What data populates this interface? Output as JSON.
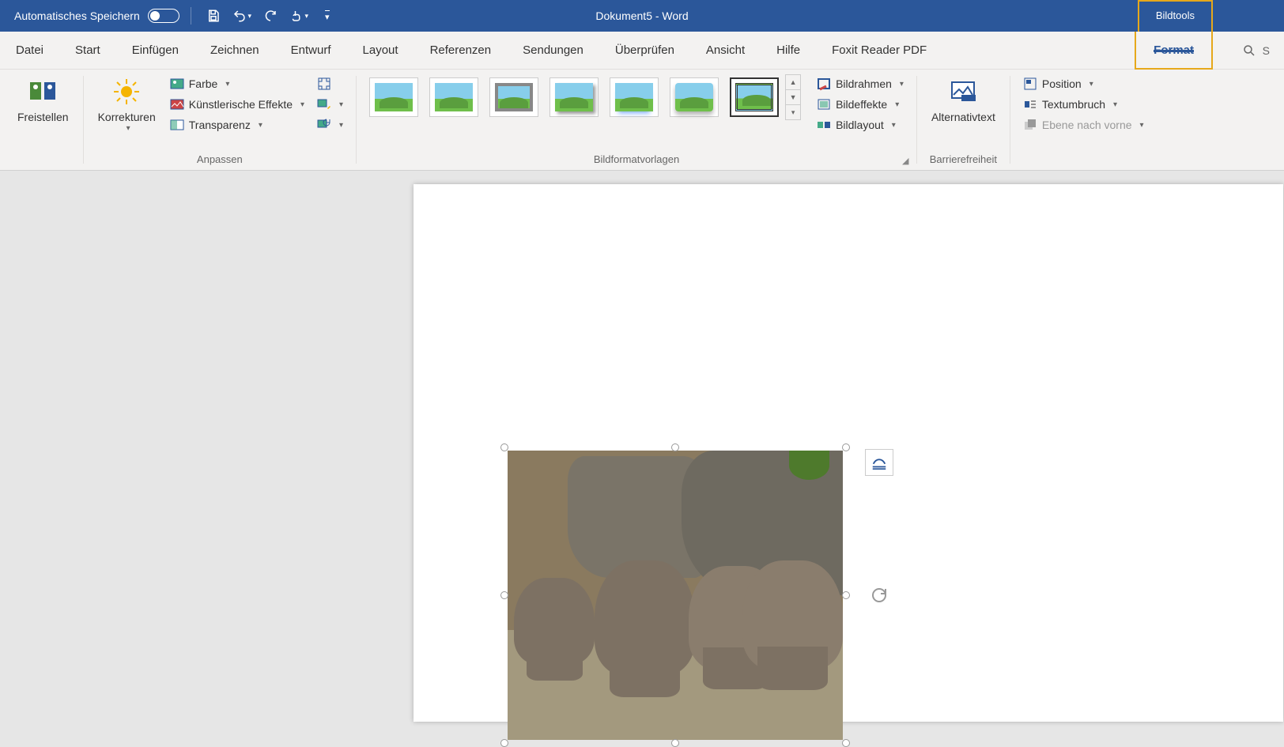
{
  "title_bar": {
    "autosave_label": "Automatisches Speichern",
    "doc_title": "Dokument5  -  Word",
    "context_tab": "Bildtools"
  },
  "tabs": {
    "datei": "Datei",
    "start": "Start",
    "einfuegen": "Einfügen",
    "zeichnen": "Zeichnen",
    "entwurf": "Entwurf",
    "layout": "Layout",
    "referenzen": "Referenzen",
    "sendungen": "Sendungen",
    "ueberpruefen": "Überprüfen",
    "ansicht": "Ansicht",
    "hilfe": "Hilfe",
    "foxit": "Foxit Reader PDF",
    "format": "Format",
    "search": "S"
  },
  "ribbon": {
    "freistellen": "Freistellen",
    "korrekturen": "Korrekturen",
    "farbe": "Farbe",
    "kuenstlerisch": "Künstlerische Effekte",
    "transparenz": "Transparenz",
    "anpassen_label": "Anpassen",
    "bildformat_label": "Bildformatvorlagen",
    "bildrahmen": "Bildrahmen",
    "bildeffekte": "Bildeffekte",
    "bildlayout": "Bildlayout",
    "alternativtext": "Alternativtext",
    "barriere_label": "Barrierefreiheit",
    "position": "Position",
    "textumbruch": "Textumbruch",
    "ebene_vorne": "Ebene nach vorne"
  }
}
